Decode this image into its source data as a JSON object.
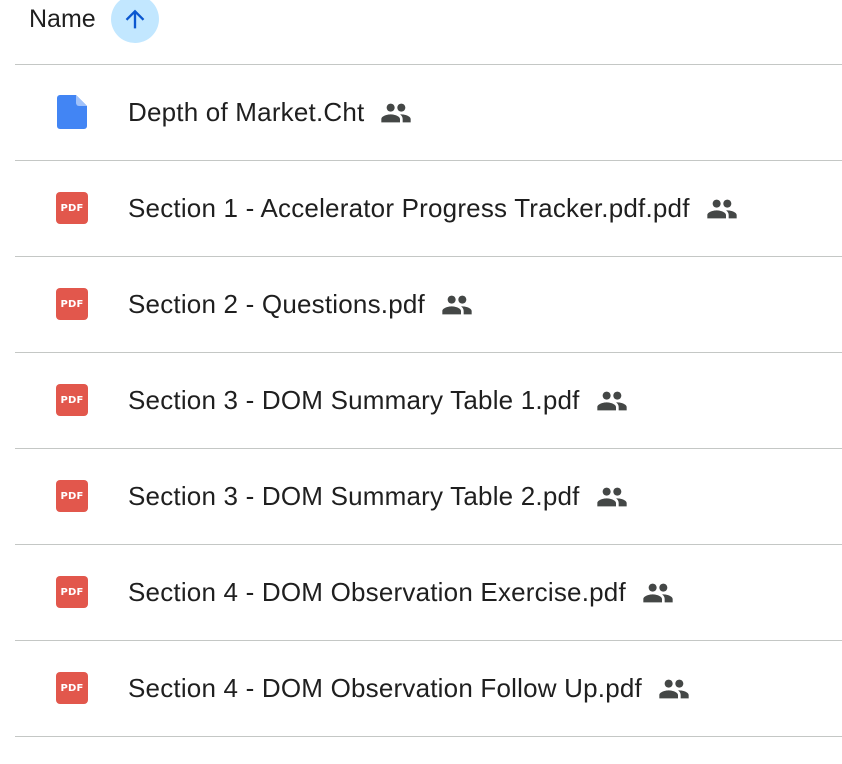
{
  "header": {
    "name_label": "Name",
    "sort_icon": "arrow-upward-icon",
    "sort_direction": "ascending"
  },
  "colors": {
    "doc_icon": "#4285f4",
    "pdf_icon": "#e2574c",
    "sort_highlight": "#c2e7ff",
    "divider": "#c4c7c5",
    "text": "#1f1f1f",
    "shared_icon": "#444746"
  },
  "files": [
    {
      "name": "Depth of Market.Cht",
      "type": "doc",
      "icon": "doc-file-icon",
      "shared": true,
      "shared_icon": "people-icon"
    },
    {
      "name": "Section 1 - Accelerator Progress Tracker.pdf.pdf",
      "type": "pdf",
      "icon": "pdf-file-icon",
      "badge": "PDF",
      "shared": true,
      "shared_icon": "people-icon"
    },
    {
      "name": "Section 2 - Questions.pdf",
      "type": "pdf",
      "icon": "pdf-file-icon",
      "badge": "PDF",
      "shared": true,
      "shared_icon": "people-icon"
    },
    {
      "name": "Section 3 - DOM Summary Table 1.pdf",
      "type": "pdf",
      "icon": "pdf-file-icon",
      "badge": "PDF",
      "shared": true,
      "shared_icon": "people-icon"
    },
    {
      "name": "Section 3 - DOM Summary Table 2.pdf",
      "type": "pdf",
      "icon": "pdf-file-icon",
      "badge": "PDF",
      "shared": true,
      "shared_icon": "people-icon"
    },
    {
      "name": "Section 4 - DOM Observation Exercise.pdf",
      "type": "pdf",
      "icon": "pdf-file-icon",
      "badge": "PDF",
      "shared": true,
      "shared_icon": "people-icon"
    },
    {
      "name": "Section 4 - DOM Observation Follow Up.pdf",
      "type": "pdf",
      "icon": "pdf-file-icon",
      "badge": "PDF",
      "shared": true,
      "shared_icon": "people-icon"
    }
  ]
}
